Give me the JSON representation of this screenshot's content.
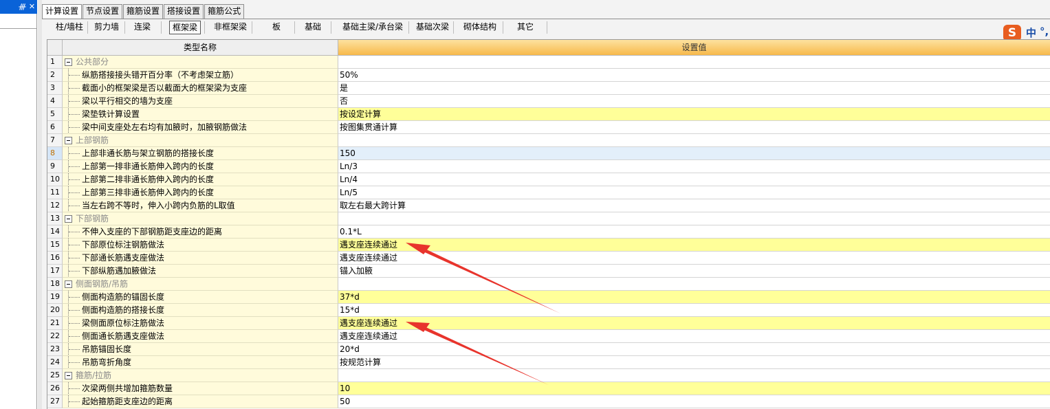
{
  "left_panel": {
    "pin_glyph": "ᚍ",
    "close_glyph": "✕"
  },
  "tabs": [
    {
      "label": "计算设置",
      "active": true
    },
    {
      "label": "节点设置",
      "active": false
    },
    {
      "label": "箍筋设置",
      "active": false
    },
    {
      "label": "搭接设置",
      "active": false
    },
    {
      "label": "箍筋公式",
      "active": false
    }
  ],
  "subtabs": [
    {
      "label": "柱/墙柱",
      "active": false
    },
    {
      "label": "剪力墙",
      "active": false
    },
    {
      "label": "连梁",
      "active": false
    },
    {
      "label": "框架梁",
      "active": true
    },
    {
      "label": "非框架梁",
      "active": false
    },
    {
      "label": "板",
      "active": false
    },
    {
      "label": "基础",
      "active": false
    },
    {
      "label": "基础主梁/承台梁",
      "active": false
    },
    {
      "label": "基础次梁",
      "active": false
    },
    {
      "label": "砌体结构",
      "active": false
    },
    {
      "label": "其它",
      "active": false
    }
  ],
  "ime": {
    "logo": "S",
    "lang": "中",
    "punct": "°,"
  },
  "table": {
    "headers": {
      "index": "",
      "name": "类型名称",
      "value": "设置值"
    },
    "rows": [
      {
        "no": "1",
        "type": "category",
        "name": "公共部分",
        "value": "",
        "highlight": false
      },
      {
        "no": "2",
        "type": "item",
        "name": "纵筋搭接接头错开百分率（不考虑架立筋）",
        "value": "50%",
        "highlight": false
      },
      {
        "no": "3",
        "type": "item",
        "name": "截面小的框架梁是否以截面大的框架梁为支座",
        "value": "是",
        "highlight": false
      },
      {
        "no": "4",
        "type": "item",
        "name": "梁以平行相交的墙为支座",
        "value": "否",
        "highlight": false
      },
      {
        "no": "5",
        "type": "item",
        "name": "梁垫铁计算设置",
        "value": "按设定计算",
        "highlight": true
      },
      {
        "no": "6",
        "type": "item",
        "name": "梁中间支座处左右均有加腋时，加腋钢筋做法",
        "value": "按图集贯通计算",
        "highlight": false
      },
      {
        "no": "7",
        "type": "category",
        "name": "上部钢筋",
        "value": "",
        "highlight": false
      },
      {
        "no": "8",
        "type": "item",
        "name": "上部非通长筋与架立钢筋的搭接长度",
        "value": "150",
        "highlight": false,
        "selected": true
      },
      {
        "no": "9",
        "type": "item",
        "name": "上部第一排非通长筋伸入跨内的长度",
        "value": "Ln/3",
        "highlight": false
      },
      {
        "no": "10",
        "type": "item",
        "name": "上部第二排非通长筋伸入跨内的长度",
        "value": "Ln/4",
        "highlight": false
      },
      {
        "no": "11",
        "type": "item",
        "name": "上部第三排非通长筋伸入跨内的长度",
        "value": "Ln/5",
        "highlight": false
      },
      {
        "no": "12",
        "type": "item",
        "name": "当左右跨不等时，伸入小跨内负筋的L取值",
        "value": "取左右最大跨计算",
        "highlight": false
      },
      {
        "no": "13",
        "type": "category",
        "name": "下部钢筋",
        "value": "",
        "highlight": false
      },
      {
        "no": "14",
        "type": "item",
        "name": "不伸入支座的下部钢筋距支座边的距离",
        "value": "0.1*L",
        "highlight": false
      },
      {
        "no": "15",
        "type": "item",
        "name": "下部原位标注钢筋做法",
        "value": "遇支座连续通过",
        "highlight": true
      },
      {
        "no": "16",
        "type": "item",
        "name": "下部通长筋遇支座做法",
        "value": "遇支座连续通过",
        "highlight": false
      },
      {
        "no": "17",
        "type": "item",
        "name": "下部纵筋遇加腋做法",
        "value": "锚入加腋",
        "highlight": false
      },
      {
        "no": "18",
        "type": "category",
        "name": "侧面钢筋/吊筋",
        "value": "",
        "highlight": false
      },
      {
        "no": "19",
        "type": "item",
        "name": "侧面构造筋的锚固长度",
        "value": "37*d",
        "highlight": true
      },
      {
        "no": "20",
        "type": "item",
        "name": "侧面构造筋的搭接长度",
        "value": "15*d",
        "highlight": false
      },
      {
        "no": "21",
        "type": "item",
        "name": "梁侧面原位标注筋做法",
        "value": "遇支座连续通过",
        "highlight": true
      },
      {
        "no": "22",
        "type": "item",
        "name": "侧面通长筋遇支座做法",
        "value": "遇支座连续通过",
        "highlight": false
      },
      {
        "no": "23",
        "type": "item",
        "name": "吊筋锚固长度",
        "value": "20*d",
        "highlight": false
      },
      {
        "no": "24",
        "type": "item",
        "name": "吊筋弯折角度",
        "value": "按规范计算",
        "highlight": false
      },
      {
        "no": "25",
        "type": "category",
        "name": "箍筋/拉筋",
        "value": "",
        "highlight": false
      },
      {
        "no": "26",
        "type": "item",
        "name": "次梁两侧共增加箍筋数量",
        "value": "10",
        "highlight": true
      },
      {
        "no": "27",
        "type": "item",
        "name": "起始箍筋距支座边的距离",
        "value": "50",
        "highlight": false
      }
    ]
  },
  "colors": {
    "header_value_bg": "#f7b94a",
    "highlight_value_bg": "#ffff99",
    "name_column_bg": "#fffbdb",
    "annotation_arrow": "#e8342c"
  }
}
